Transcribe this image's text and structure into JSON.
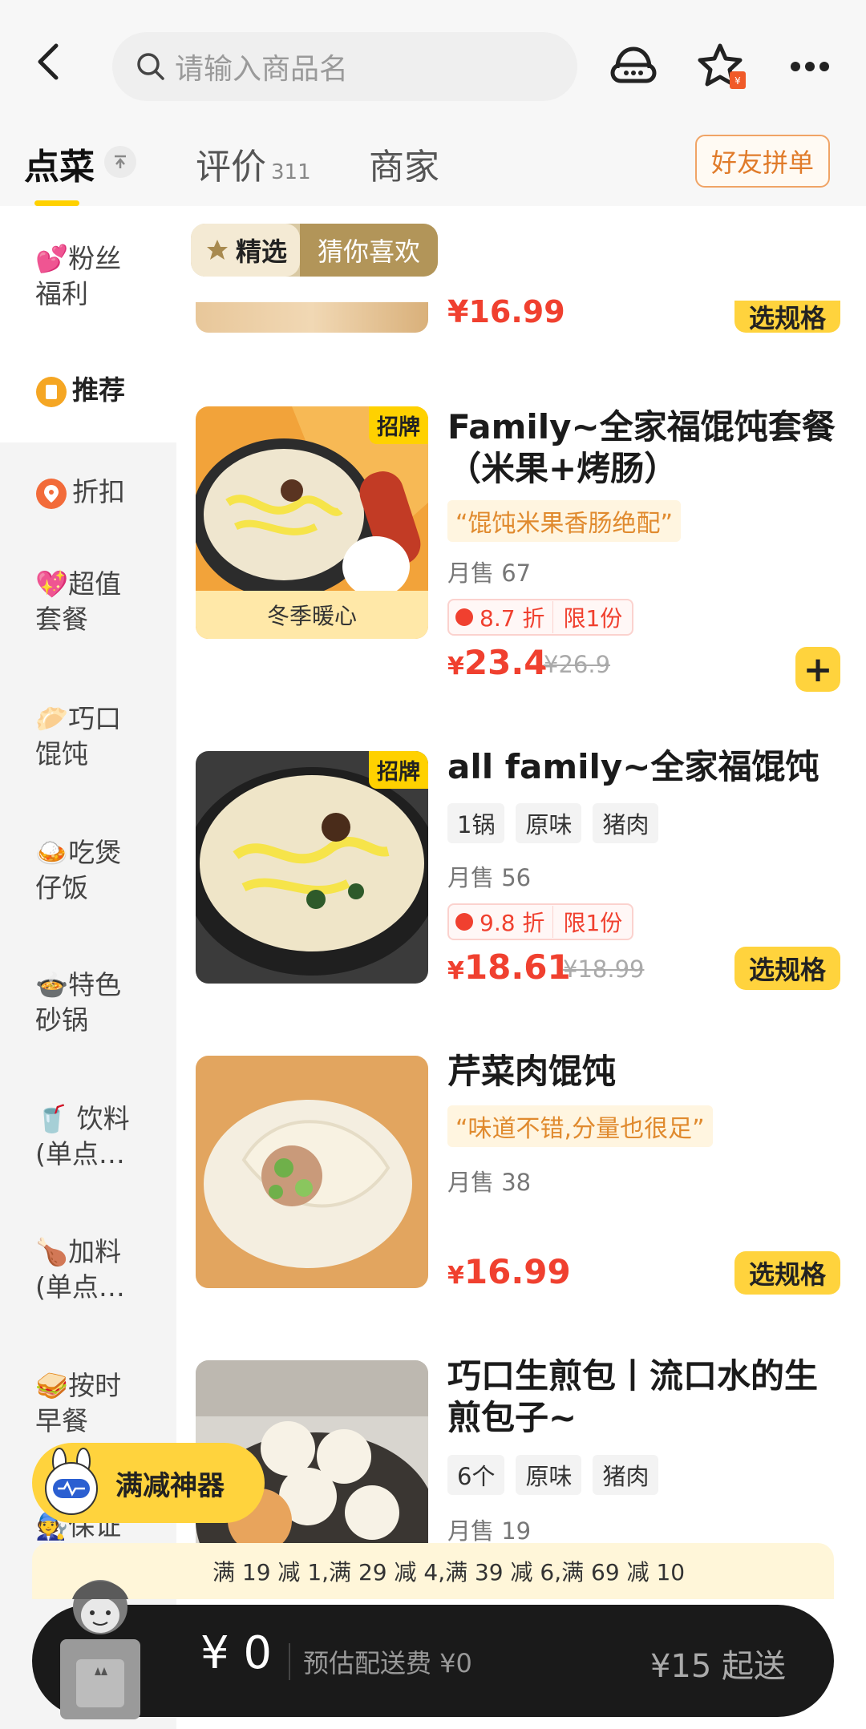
{
  "header": {
    "search_placeholder": "请输入商品名"
  },
  "tabs": [
    {
      "label": "点菜",
      "active": true
    },
    {
      "label": "评价",
      "count": "311"
    },
    {
      "label": "商家"
    }
  ],
  "group_order_button": "好友拼单",
  "sidebar": {
    "items": [
      {
        "icon": "hearts-icon",
        "line1": "💕粉丝",
        "line2": "福利"
      },
      {
        "icon": "recommend-icon",
        "line1": "推荐",
        "active": true
      },
      {
        "icon": "discount-tag-icon",
        "line1": "折扣"
      },
      {
        "icon": "heart-gift-icon",
        "line1": "💖超值",
        "line2": "套餐"
      },
      {
        "icon": "dumpling-icon",
        "line1": "🥟巧口",
        "line2": "馄饨"
      },
      {
        "icon": "claypot-rice-icon",
        "line1": "🍛吃煲",
        "line2": "仔饭"
      },
      {
        "icon": "soup-pot-icon",
        "line1": "🍲特色",
        "line2": "砂锅"
      },
      {
        "icon": "drink-icon",
        "line1": "🥤 饮料",
        "line2": "(单点…"
      },
      {
        "icon": "drumstick-icon",
        "line1": "🍗加料",
        "line2": "(单点…"
      },
      {
        "icon": "sandwich-icon",
        "line1": "🥪按时",
        "line2": "早餐"
      },
      {
        "icon": "worker-icon",
        "line1": "🧑‍🔧保证"
      }
    ]
  },
  "filter": {
    "selected": "精选",
    "other": "猜你喜欢"
  },
  "partial_item": {
    "price": "¥16.99",
    "spec_label": "选规格"
  },
  "items": [
    {
      "badge": "招牌",
      "thumb_caption": "冬季暖心",
      "title": "Family~全家福馄饨套餐（米果+烤肠）",
      "quote": "“馄饨米果香肠绝配”",
      "sold": "月售 67",
      "discount": "8.7 折",
      "limit": "限1份",
      "price_symbol": "¥",
      "price": "23.4",
      "original_price": "¥26.9",
      "action": "+"
    },
    {
      "badge": "招牌",
      "title": "all family~全家福馄饨",
      "tags": [
        "1锅",
        "原味",
        "猪肉"
      ],
      "sold": "月售 56",
      "discount": "9.8 折",
      "limit": "限1份",
      "price_symbol": "¥",
      "price": "18.61",
      "original_price": "¥18.99",
      "action": "选规格"
    },
    {
      "title": "芹菜肉馄饨",
      "quote": "“味道不错,分量也很足”",
      "sold": "月售 38",
      "price_symbol": "¥",
      "price": "16.99",
      "action": "选规格"
    },
    {
      "title": "巧口生煎包丨流口水的生煎包子~",
      "tags": [
        "6个",
        "原味",
        "猪肉"
      ],
      "sold": "月售 19"
    }
  ],
  "promo_float": "满减神器",
  "discount_strip": "满 19 减 1,满 29 减 4,满 39 减 6,满 69 减 10",
  "cart": {
    "amount": "¥ 0",
    "delivery_fee": "预估配送费 ¥0",
    "min_order": "¥15 起送"
  },
  "colors": {
    "accent_yellow": "#ffd33d",
    "price_red": "#f0402f",
    "cart_bg": "#1a1a1a"
  }
}
